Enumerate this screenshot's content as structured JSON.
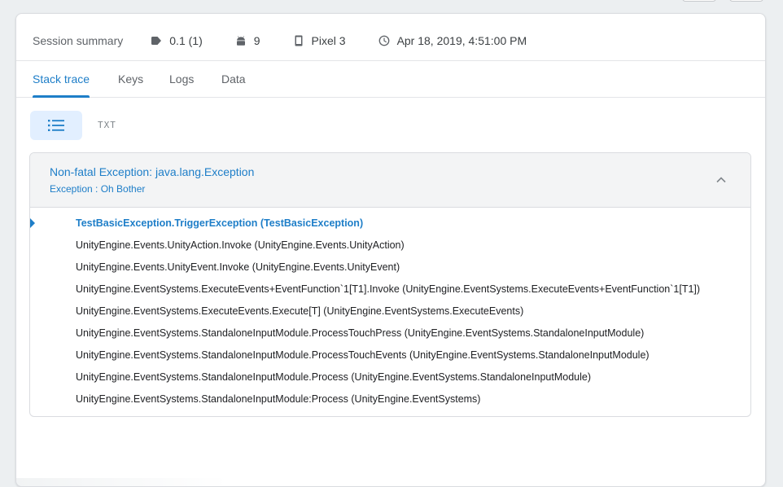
{
  "summary": {
    "label": "Session summary",
    "version": "0.1 (1)",
    "api_level": "9",
    "device": "Pixel 3",
    "timestamp": "Apr 18, 2019, 4:51:00 PM",
    "icons": [
      "tag-icon",
      "android-icon",
      "phone-icon",
      "clock-icon"
    ]
  },
  "tabs": [
    {
      "label": "Stack trace",
      "active": true
    },
    {
      "label": "Keys",
      "active": false
    },
    {
      "label": "Logs",
      "active": false
    },
    {
      "label": "Data",
      "active": false
    }
  ],
  "view": {
    "list_icon": "list-icon",
    "txt_label": "TXT"
  },
  "exception": {
    "title": "Non-fatal Exception: java.lang.Exception",
    "subtitle": "Exception : Oh Bother",
    "frames": [
      "TestBasicException.TriggerException (TestBasicException)",
      "UnityEngine.Events.UnityAction.Invoke (UnityEngine.Events.UnityAction)",
      "UnityEngine.Events.UnityEvent.Invoke (UnityEngine.Events.UnityEvent)",
      "UnityEngine.EventSystems.ExecuteEvents+EventFunction`1[T1].Invoke (UnityEngine.EventSystems.ExecuteEvents+EventFunction`1[T1])",
      "UnityEngine.EventSystems.ExecuteEvents.Execute[T] (UnityEngine.EventSystems.ExecuteEvents)",
      "UnityEngine.EventSystems.StandaloneInputModule.ProcessTouchPress (UnityEngine.EventSystems.StandaloneInputModule)",
      "UnityEngine.EventSystems.StandaloneInputModule.ProcessTouchEvents (UnityEngine.EventSystems.StandaloneInputModule)",
      "UnityEngine.EventSystems.StandaloneInputModule.Process (UnityEngine.EventSystems.StandaloneInputModule)",
      "UnityEngine.EventSystems.StandaloneInputModule:Process (UnityEngine.EventSystems)"
    ]
  },
  "colors": {
    "accent": "#1e7ec8",
    "toggle_bg": "#e2efff",
    "header_bg": "#f3f4f5",
    "page_bg": "#eceff1"
  }
}
